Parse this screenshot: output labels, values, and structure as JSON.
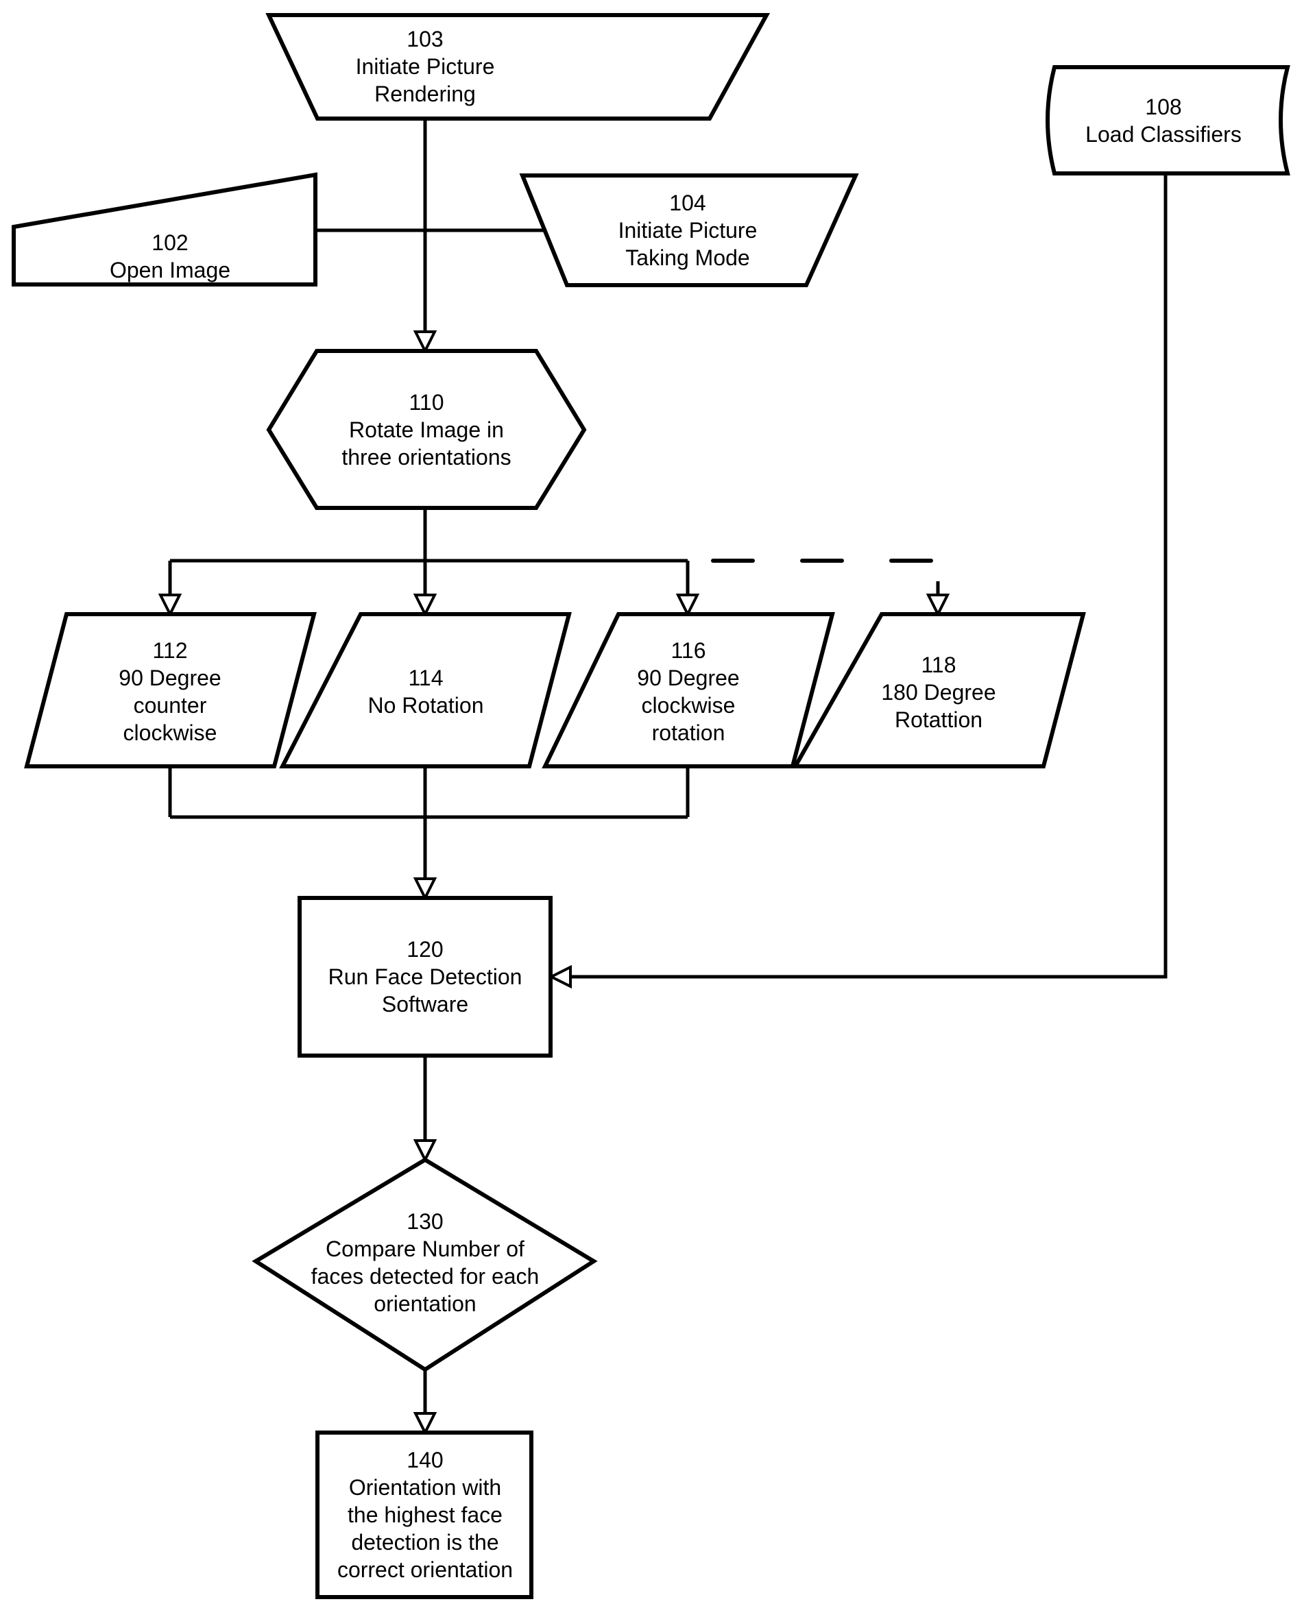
{
  "nodes": {
    "n103": {
      "id": "103",
      "lines": [
        "Initiate Picture",
        "Rendering"
      ],
      "shape": "trapezoid-inverted"
    },
    "n102": {
      "id": "102",
      "lines": [
        "Open Image"
      ],
      "shape": "manual-input"
    },
    "n104": {
      "id": "104",
      "lines": [
        "Initiate Picture",
        "Taking Mode"
      ],
      "shape": "trapezoid-inverted"
    },
    "n108": {
      "id": "108",
      "lines": [
        "Load Classifiers"
      ],
      "shape": "stored-data"
    },
    "n110": {
      "id": "110",
      "lines": [
        "Rotate Image in",
        "three orientations"
      ],
      "shape": "hexagon"
    },
    "n112": {
      "id": "112",
      "lines": [
        "90 Degree",
        "counter",
        "clockwise"
      ],
      "shape": "parallelogram"
    },
    "n114": {
      "id": "114",
      "lines": [
        "No Rotation"
      ],
      "shape": "parallelogram"
    },
    "n116": {
      "id": "116",
      "lines": [
        "90 Degree",
        "clockwise",
        "rotation"
      ],
      "shape": "parallelogram"
    },
    "n118": {
      "id": "118",
      "lines": [
        "180 Degree",
        "Rotattion"
      ],
      "shape": "parallelogram"
    },
    "n120": {
      "id": "120",
      "lines": [
        "Run Face Detection",
        "Software"
      ],
      "shape": "rectangle"
    },
    "n130": {
      "id": "130",
      "lines": [
        "Compare Number of",
        "faces detected for each",
        "orientation"
      ],
      "shape": "diamond"
    },
    "n140": {
      "id": "140",
      "lines": [
        "Orientation with",
        "the highest face",
        "detection is the",
        "correct orientation"
      ],
      "shape": "rectangle"
    }
  },
  "edges": [
    {
      "from": "103",
      "to": "110",
      "style": "solid"
    },
    {
      "from": "102",
      "to": "110",
      "style": "solid"
    },
    {
      "from": "104",
      "to": "110",
      "style": "solid"
    },
    {
      "from": "110",
      "to": "112",
      "style": "solid"
    },
    {
      "from": "110",
      "to": "114",
      "style": "solid"
    },
    {
      "from": "110",
      "to": "116",
      "style": "solid"
    },
    {
      "from": "110",
      "to": "118",
      "style": "dashed"
    },
    {
      "from": "112",
      "to": "120",
      "style": "solid"
    },
    {
      "from": "114",
      "to": "120",
      "style": "solid"
    },
    {
      "from": "116",
      "to": "120",
      "style": "solid"
    },
    {
      "from": "108",
      "to": "120",
      "style": "solid"
    },
    {
      "from": "120",
      "to": "130",
      "style": "solid"
    },
    {
      "from": "130",
      "to": "140",
      "style": "solid"
    }
  ],
  "colors": {
    "stroke": "#000000",
    "fill": "#ffffff"
  }
}
